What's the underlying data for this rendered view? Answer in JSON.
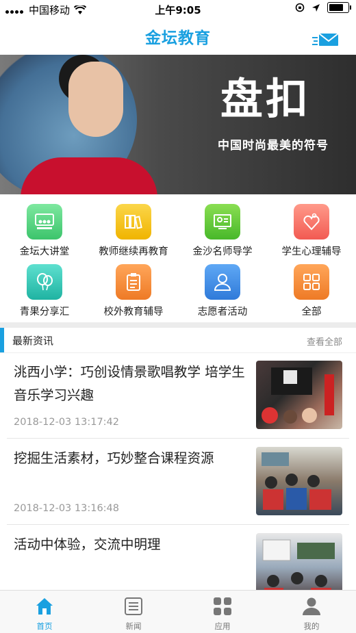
{
  "status_bar": {
    "carrier": "中国移动",
    "time": "上午9:05"
  },
  "header": {
    "title": "金坛教育"
  },
  "banner": {
    "calligraphy": "盘扣",
    "slogan": "中国时尚最美的符号"
  },
  "shortcuts": [
    {
      "label": "金坛大讲堂",
      "color": "#4cd07a",
      "icon": "lecture-hall-icon"
    },
    {
      "label": "教师继续再教育",
      "color": "#f5c518",
      "icon": "books-icon"
    },
    {
      "label": "金沙名师导学",
      "color": "#57c834",
      "icon": "teacher-board-icon"
    },
    {
      "label": "学生心理辅导",
      "color": "#f7706a",
      "icon": "heart-icon"
    },
    {
      "label": "青果分享汇",
      "color": "#2ec4b6",
      "icon": "balloons-icon"
    },
    {
      "label": "校外教育辅导",
      "color": "#f2873a",
      "icon": "clipboard-icon"
    },
    {
      "label": "志愿者活动",
      "color": "#3d8ee8",
      "icon": "person-icon"
    },
    {
      "label": "全部",
      "color": "#f2873a",
      "icon": "grid-icon"
    }
  ],
  "news_section": {
    "title": "最新资讯",
    "more": "查看全部"
  },
  "news": [
    {
      "title": "洮西小学：巧创设情景歌唱教学 培学生音乐学习兴趣",
      "time": "2018-12-03 13:17:42"
    },
    {
      "title": "挖掘生活素材，巧妙整合课程资源",
      "time": "2018-12-03 13:16:48"
    },
    {
      "title": "活动中体验，交流中明理",
      "time": ""
    }
  ],
  "tabs": [
    {
      "label": "首页",
      "icon": "home-icon",
      "active": true
    },
    {
      "label": "新闻",
      "icon": "news-icon",
      "active": false
    },
    {
      "label": "应用",
      "icon": "apps-icon",
      "active": false
    },
    {
      "label": "我的",
      "icon": "profile-icon",
      "active": false
    }
  ],
  "colors": {
    "accent": "#1aa0e0"
  }
}
